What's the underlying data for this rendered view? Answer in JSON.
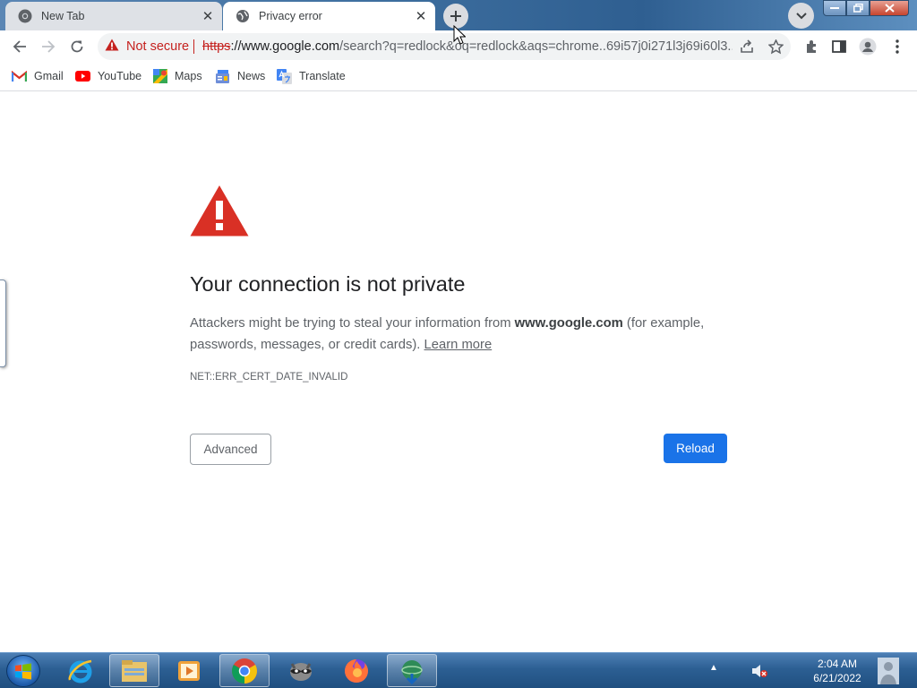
{
  "tabs": [
    {
      "title": "New Tab",
      "icon": "chrome-icon",
      "active": false
    },
    {
      "title": "Privacy error",
      "icon": "globe-icon",
      "active": true
    }
  ],
  "toolbar": {
    "security_label": "Not secure",
    "url_scheme": "https",
    "url_host": "://www.google.com",
    "url_rest": "/search?q=redlock&oq=redlock&aqs=chrome..69i57j0i271l3j69i60l3...."
  },
  "bookmarks": [
    {
      "label": "Gmail",
      "icon": "gmail-icon"
    },
    {
      "label": "YouTube",
      "icon": "youtube-icon"
    },
    {
      "label": "Maps",
      "icon": "maps-icon"
    },
    {
      "label": "News",
      "icon": "news-icon"
    },
    {
      "label": "Translate",
      "icon": "translate-icon"
    }
  ],
  "interstitial": {
    "heading": "Your connection is not private",
    "desc_prefix": "Attackers might be trying to steal your information from ",
    "desc_host": "www.google.com",
    "desc_suffix": " (for example, passwords, messages, or credit cards). ",
    "learn_more": "Learn more",
    "error_code": "NET::ERR_CERT_DATE_INVALID",
    "advanced_label": "Advanced",
    "reload_label": "Reload"
  },
  "taskbar": {
    "apps": [
      "internet-explorer-icon",
      "file-explorer-icon",
      "media-player-icon",
      "chrome-icon",
      "raccoon-app-icon",
      "firefox-icon",
      "download-manager-icon"
    ],
    "time": "2:04 AM",
    "date": "6/21/2022"
  },
  "colors": {
    "danger": "#c5221f",
    "accent": "#1a73e8",
    "warning_red": "#d93025"
  }
}
